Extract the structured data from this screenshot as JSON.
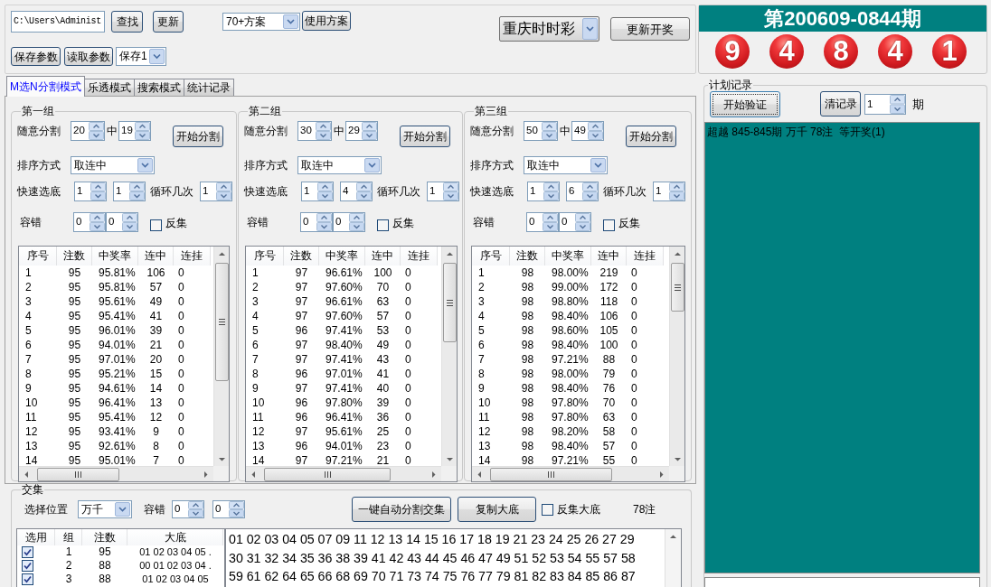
{
  "toolbar": {
    "path": {
      "value": "C:\\Users\\Administ"
    },
    "find_button": "查找",
    "update_button": "更新",
    "scheme_select": {
      "value": "70+方案"
    },
    "use_scheme_button": "使用方案",
    "save_params_button": "保存参数",
    "load_params_button": "读取参数",
    "slot_select": {
      "value": "保存1"
    },
    "lottery_select": {
      "value": "重庆时时彩"
    },
    "refresh_draw_button": "更新开奖"
  },
  "tabs": [
    {
      "label": "M选N分割模式",
      "selected": true
    },
    {
      "label": "乐透模式",
      "selected": false
    },
    {
      "label": "搜索模式",
      "selected": false
    },
    {
      "label": "统计记录",
      "selected": false
    }
  ],
  "groups": [
    {
      "title": "第一组",
      "split_label": "随意分割",
      "split_total": "20",
      "split_middle": "中",
      "split_hit": "19",
      "start_button": "开始分割",
      "sort_label": "排序方式",
      "sort_value": "取连中",
      "quick_label": "快速选底",
      "quick_from": "1",
      "quick_to": "1",
      "loop_label": "循环几次",
      "loop_count": "1",
      "tolerance_label": "容错",
      "tolerance_from": "0",
      "tolerance_to": "0",
      "invert": {
        "label": "反集",
        "checked": false
      },
      "table": {
        "columns": [
          "序号",
          "注数",
          "中奖率",
          "连中",
          "连挂"
        ],
        "rows": [
          [
            "1",
            "95",
            "95.81%",
            "106",
            "0"
          ],
          [
            "2",
            "95",
            "95.81%",
            "57",
            "0"
          ],
          [
            "3",
            "95",
            "95.61%",
            "49",
            "0"
          ],
          [
            "4",
            "95",
            "95.41%",
            "41",
            "0"
          ],
          [
            "5",
            "95",
            "96.01%",
            "39",
            "0"
          ],
          [
            "6",
            "95",
            "94.01%",
            "21",
            "0"
          ],
          [
            "7",
            "95",
            "97.01%",
            "20",
            "0"
          ],
          [
            "8",
            "95",
            "95.21%",
            "15",
            "0"
          ],
          [
            "9",
            "95",
            "94.61%",
            "14",
            "0"
          ],
          [
            "10",
            "95",
            "96.41%",
            "13",
            "0"
          ],
          [
            "11",
            "95",
            "95.41%",
            "12",
            "0"
          ],
          [
            "12",
            "95",
            "93.41%",
            "9",
            "0"
          ],
          [
            "13",
            "95",
            "92.61%",
            "8",
            "0"
          ],
          [
            "14",
            "95",
            "95.01%",
            "7",
            "0"
          ]
        ]
      }
    },
    {
      "title": "第二组",
      "split_label": "随意分割",
      "split_total": "30",
      "split_middle": "中",
      "split_hit": "29",
      "start_button": "开始分割",
      "sort_label": "排序方式",
      "sort_value": "取连中",
      "quick_label": "快速选底",
      "quick_from": "1",
      "quick_to": "4",
      "loop_label": "循环几次",
      "loop_count": "1",
      "tolerance_label": "容错",
      "tolerance_from": "0",
      "tolerance_to": "0",
      "invert": {
        "label": "反集",
        "checked": false
      },
      "table": {
        "columns": [
          "序号",
          "注数",
          "中奖率",
          "连中",
          "连挂"
        ],
        "rows": [
          [
            "1",
            "97",
            "96.61%",
            "100",
            "0"
          ],
          [
            "2",
            "97",
            "97.60%",
            "70",
            "0"
          ],
          [
            "3",
            "97",
            "96.61%",
            "63",
            "0"
          ],
          [
            "4",
            "97",
            "97.60%",
            "57",
            "0"
          ],
          [
            "5",
            "96",
            "97.41%",
            "53",
            "0"
          ],
          [
            "6",
            "97",
            "98.40%",
            "49",
            "0"
          ],
          [
            "7",
            "97",
            "97.41%",
            "43",
            "0"
          ],
          [
            "8",
            "96",
            "97.01%",
            "41",
            "0"
          ],
          [
            "9",
            "97",
            "97.41%",
            "40",
            "0"
          ],
          [
            "10",
            "96",
            "97.80%",
            "39",
            "0"
          ],
          [
            "11",
            "96",
            "96.41%",
            "36",
            "0"
          ],
          [
            "12",
            "97",
            "95.61%",
            "25",
            "0"
          ],
          [
            "13",
            "96",
            "94.01%",
            "23",
            "0"
          ],
          [
            "14",
            "97",
            "97.21%",
            "21",
            "0"
          ]
        ]
      }
    },
    {
      "title": "第三组",
      "split_label": "随意分割",
      "split_total": "50",
      "split_middle": "中",
      "split_hit": "49",
      "start_button": "开始分割",
      "sort_label": "排序方式",
      "sort_value": "取连中",
      "quick_label": "快速选底",
      "quick_from": "1",
      "quick_to": "6",
      "loop_label": "循环几次",
      "loop_count": "1",
      "tolerance_label": "容错",
      "tolerance_from": "0",
      "tolerance_to": "0",
      "invert": {
        "label": "反集",
        "checked": false
      },
      "table": {
        "columns": [
          "序号",
          "注数",
          "中奖率",
          "连中",
          "连挂"
        ],
        "rows": [
          [
            "1",
            "98",
            "98.00%",
            "219",
            "0"
          ],
          [
            "2",
            "98",
            "99.00%",
            "172",
            "0"
          ],
          [
            "3",
            "98",
            "98.80%",
            "118",
            "0"
          ],
          [
            "4",
            "98",
            "98.40%",
            "106",
            "0"
          ],
          [
            "5",
            "98",
            "98.60%",
            "105",
            "0"
          ],
          [
            "6",
            "98",
            "98.40%",
            "100",
            "0"
          ],
          [
            "7",
            "98",
            "97.21%",
            "88",
            "0"
          ],
          [
            "8",
            "98",
            "98.00%",
            "79",
            "0"
          ],
          [
            "9",
            "98",
            "98.40%",
            "76",
            "0"
          ],
          [
            "10",
            "98",
            "97.80%",
            "70",
            "0"
          ],
          [
            "11",
            "98",
            "97.80%",
            "63",
            "0"
          ],
          [
            "12",
            "98",
            "98.20%",
            "58",
            "0"
          ],
          [
            "13",
            "98",
            "98.40%",
            "57",
            "0"
          ],
          [
            "14",
            "98",
            "97.21%",
            "55",
            "0"
          ]
        ]
      }
    }
  ],
  "intersection": {
    "title": "交集",
    "position_label": "选择位置",
    "position_value": "万千",
    "tolerance_label": "容错",
    "tolerance_from": "0",
    "tolerance_to": "0",
    "auto_button": "一键自动分割交集",
    "copy_button": "复制大底",
    "invert": {
      "label": "反集大底",
      "checked": false
    },
    "count": "78注",
    "table": {
      "check_column": "选用",
      "columns": [
        "组",
        "注数",
        "大底"
      ],
      "rows": [
        {
          "checked": true,
          "cells": [
            "1",
            "95",
            "01 02 03 04 05 ."
          ]
        },
        {
          "checked": true,
          "cells": [
            "2",
            "88",
            "00 01 02 03 04 ."
          ]
        },
        {
          "checked": true,
          "cells": [
            "3",
            "88",
            "01 02 03 04 05"
          ]
        }
      ]
    },
    "numbers": [
      "01 02 03 04 05 07 09 11 12 13 14 15 16 17 18 19 21 23 24 25 26 27 29",
      "30 31 32 34 35 36 38 39 41 42 43 44 45 46 47 49 51 52 53 54 55 57 58",
      "59 61 62 64 65 66 68 69 70 71 73 74 75 76 77 79 81 82 83 84 85 86 87"
    ]
  },
  "draw": {
    "title": "第200609-0844期",
    "balls": [
      "9",
      "4",
      "8",
      "4",
      "1"
    ]
  },
  "plan": {
    "title": "计划记录",
    "verify_button": {
      "label": "开始验证",
      "focused": true
    },
    "clear_button": "清记录",
    "periods": "1",
    "periods_unit": "期",
    "log": [
      "超越 845-845期 万千 78注  等开奖(1)"
    ]
  }
}
